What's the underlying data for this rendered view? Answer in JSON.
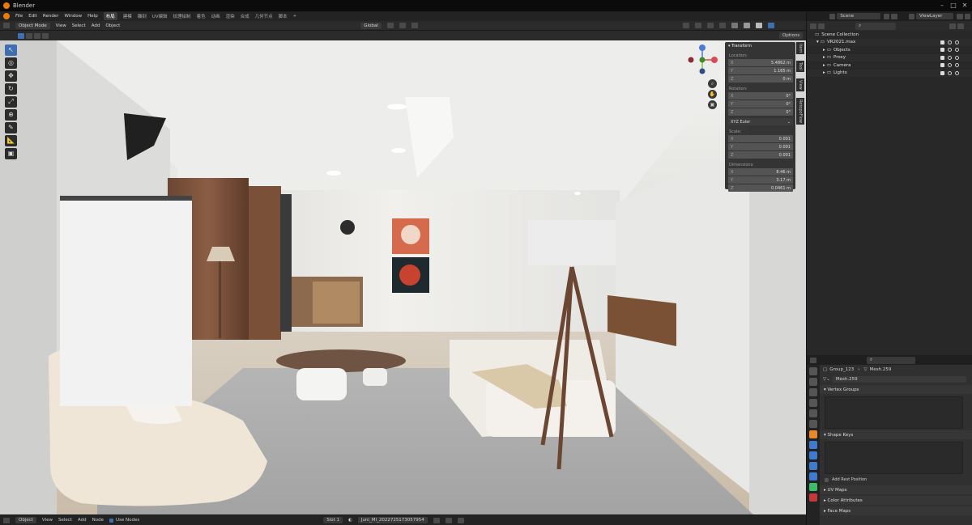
{
  "app": {
    "title": "Blender"
  },
  "menu": {
    "items": [
      "File",
      "Edit",
      "Render",
      "Window",
      "Help"
    ],
    "workspaces": [
      "布局",
      "建模",
      "雕刻",
      "UV编辑",
      "纹理绘制",
      "着色",
      "动画",
      "渲染",
      "合成",
      "几何节点",
      "脚本"
    ],
    "active_workspace": "布局",
    "add_tab": "+"
  },
  "scene": {
    "label": "Scene",
    "view_layer": "ViewLayer"
  },
  "viewport_header": {
    "mode": "Object Mode",
    "menus": [
      "View",
      "Select",
      "Add",
      "Object"
    ],
    "orientation": "Global",
    "options": "Options"
  },
  "transform": {
    "title": "Transform",
    "location_label": "Location:",
    "location": [
      {
        "axis": "X",
        "value": "5.4862 m"
      },
      {
        "axis": "Y",
        "value": "1.165 m"
      },
      {
        "axis": "Z",
        "value": "0 m"
      }
    ],
    "rotation_label": "Rotation:",
    "rotation": [
      {
        "axis": "X",
        "value": "0°"
      },
      {
        "axis": "Y",
        "value": "0°"
      },
      {
        "axis": "Z",
        "value": "0°"
      }
    ],
    "rotation_mode": "XYZ Euler",
    "scale_label": "Scale:",
    "scale": [
      {
        "axis": "X",
        "value": "0.001"
      },
      {
        "axis": "Y",
        "value": "0.001"
      },
      {
        "axis": "Z",
        "value": "0.001"
      }
    ],
    "dimensions_label": "Dimensions:",
    "dimensions": [
      {
        "axis": "X",
        "value": "8.46 m"
      },
      {
        "axis": "Y",
        "value": "3.17 m"
      },
      {
        "axis": "Z",
        "value": "0.0461 m"
      }
    ]
  },
  "side_tabs": [
    "Item",
    "Tool",
    "View",
    "RetopoFlow"
  ],
  "gizmo": {
    "x": "X",
    "y": "Y",
    "z": "Z"
  },
  "outliner": {
    "root": "Scene Collection",
    "items": [
      {
        "label": "VR2021.max",
        "indent": 1
      },
      {
        "label": "Objects",
        "indent": 2
      },
      {
        "label": "Proxy",
        "indent": 2
      },
      {
        "label": "Camera",
        "indent": 2
      },
      {
        "label": "Lights",
        "indent": 2
      }
    ]
  },
  "properties": {
    "object_name": "Group_123",
    "mesh_name": "Mesh.259",
    "datablock": "Mesh.259",
    "panels": [
      "Vertex Groups",
      "Shape Keys",
      "UV Maps",
      "Color Attributes",
      "Face Maps"
    ],
    "add_rest_position": "Add Rest Position"
  },
  "status": {
    "type": "Object",
    "menus": [
      "View",
      "Select",
      "Add",
      "Node"
    ],
    "use_nodes": "Use Nodes",
    "slot": "Slot 1",
    "material": "Juni_MI_2022725173057954"
  }
}
